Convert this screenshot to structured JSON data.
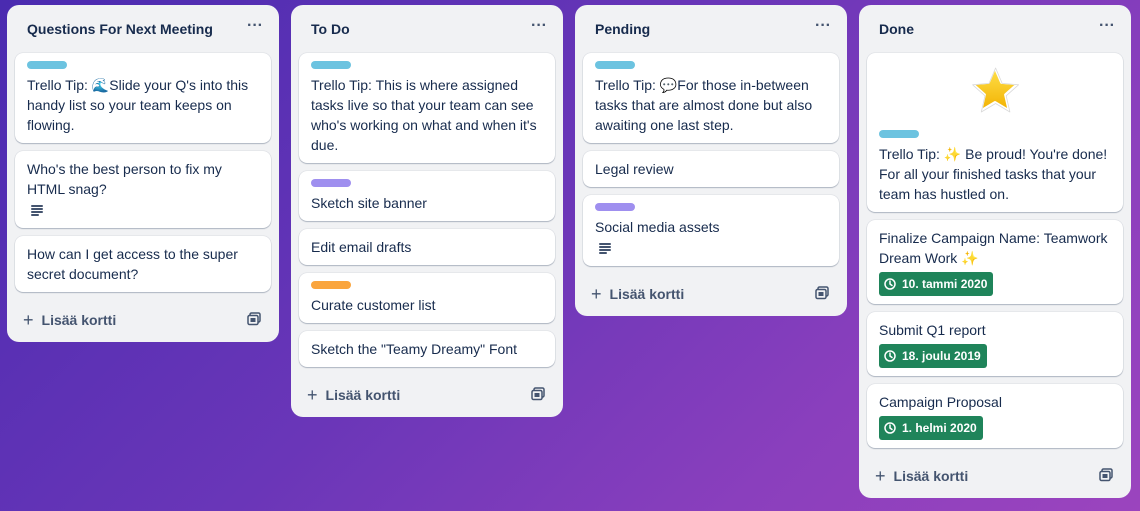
{
  "colors": {
    "label_blue": "#6cc3e0",
    "label_purple": "#9f8fef",
    "label_orange": "#faa53d",
    "date_green": "#1f845a"
  },
  "icons": {
    "more": "more-dots-icon",
    "add": "plus-icon",
    "template": "card-template-icon",
    "description": "description-lines-icon",
    "clock": "clock-icon",
    "star": "star-icon"
  },
  "footer": {
    "add_label": "Lisää kortti"
  },
  "lists": [
    {
      "title": "Questions For Next Meeting",
      "cards": [
        {
          "text": "Trello Tip: 🌊Slide your Q's into this handy list so your team keeps on flowing.",
          "label": "label_blue"
        },
        {
          "text": "Who's the best person to fix my HTML snag?",
          "has_description": true
        },
        {
          "text": "How can I get access to the super secret document?"
        }
      ]
    },
    {
      "title": "To Do",
      "cards": [
        {
          "text": "Trello Tip: This is where assigned tasks live so that your team can see who's working on what and when it's due.",
          "label": "label_blue"
        },
        {
          "text": "Sketch site banner",
          "label": "label_purple"
        },
        {
          "text": "Edit email drafts"
        },
        {
          "text": "Curate customer list",
          "label": "label_orange"
        },
        {
          "text": "Sketch the \"Teamy Dreamy\" Font"
        }
      ]
    },
    {
      "title": "Pending",
      "cards": [
        {
          "text": "Trello Tip: 💬For those in-between tasks that are almost done but also awaiting one last step.",
          "label": "label_blue"
        },
        {
          "text": "Legal review"
        },
        {
          "text": "Social media assets",
          "label": "label_purple",
          "has_description": true
        }
      ]
    },
    {
      "title": "Done",
      "cards": [
        {
          "text": "Trello Tip: ✨ Be proud! You're done! For all your finished tasks that your team has hustled on.",
          "label": "label_blue",
          "has_star": true
        },
        {
          "text": "Finalize Campaign Name: Teamwork Dream Work ✨",
          "date": "10. tammi 2020"
        },
        {
          "text": "Submit Q1 report",
          "date": "18. joulu 2019"
        },
        {
          "text": "Campaign Proposal",
          "date": "1. helmi 2020"
        }
      ]
    }
  ]
}
